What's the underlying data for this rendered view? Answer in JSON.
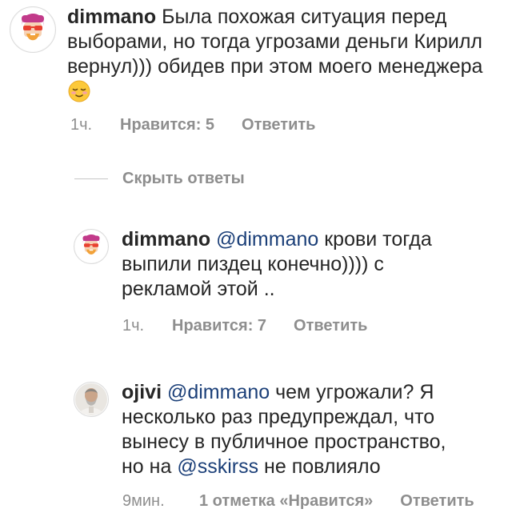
{
  "comments": [
    {
      "username": "dimmano",
      "text": "Была похожая ситуация перед выборами, но тогда угрозами деньги Кирилл вернул))) обидев при этом моего менеджера",
      "emoji": "relieved-face",
      "time": "1ч.",
      "likes": "Нравится: 5",
      "reply": "Ответить"
    }
  ],
  "replies_toggle": "Скрыть ответы",
  "replies": [
    {
      "username": "dimmano",
      "mention": "@dimmano",
      "text": "крови тогда выпили пиздец конечно)))) с рекламой этой ..",
      "time": "1ч.",
      "likes": "Нравится: 7",
      "reply": "Ответить"
    },
    {
      "username": "ojivi",
      "mention": "@dimmano",
      "text_before": "чем угрожали? Я несколько раз предупреждал, что вынесу в публичное пространство, но на",
      "mention2": "@sskirss",
      "text_after": "не повлияло",
      "time": "9мин.",
      "likes": "1 отметка «Нравится»",
      "reply": "Ответить"
    }
  ],
  "colors": {
    "text": "#262626",
    "meta": "#8e8e8e",
    "mention": "#1b3f78",
    "avatar_dimmano_hair": "#c23a8a",
    "avatar_dimmano_glasses": "#e8412f",
    "avatar_dimmano_beard": "#f2a23a"
  }
}
